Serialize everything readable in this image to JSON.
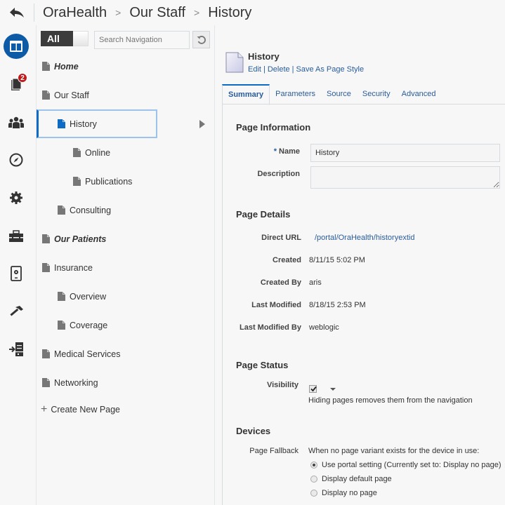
{
  "breadcrumb": [
    "OraHealth",
    "Our Staff",
    "History"
  ],
  "rail": {
    "items": [
      {
        "name": "pages-icon",
        "active": true
      },
      {
        "name": "assets-icon",
        "badge": "2"
      },
      {
        "name": "users-icon"
      },
      {
        "name": "navigation-icon"
      },
      {
        "name": "settings-icon"
      },
      {
        "name": "toolbox-icon"
      },
      {
        "name": "device-settings-icon"
      },
      {
        "name": "build-icon"
      },
      {
        "name": "import-export-icon"
      }
    ]
  },
  "nav": {
    "toggle_label": "All",
    "search_placeholder": "Search Navigation",
    "items": [
      {
        "label": "Home",
        "level": 0,
        "italic": true
      },
      {
        "label": "Our Staff",
        "level": 0
      },
      {
        "label": "History",
        "level": 1,
        "selected": true
      },
      {
        "label": "Online",
        "level": 2
      },
      {
        "label": "Publications",
        "level": 2
      },
      {
        "label": "Consulting",
        "level": 1
      },
      {
        "label": "Our Patients",
        "level": 0,
        "italic": true
      },
      {
        "label": "Insurance",
        "level": 0
      },
      {
        "label": "Overview",
        "level": 1
      },
      {
        "label": "Coverage",
        "level": 1
      },
      {
        "label": "Medical Services",
        "level": 0
      },
      {
        "label": "Networking",
        "level": 0
      }
    ],
    "create_label": "Create New Page"
  },
  "page": {
    "title": "History",
    "actions": [
      "Edit",
      "Delete",
      "Save As Page Style"
    ],
    "tabs": [
      "Summary",
      "Parameters",
      "Source",
      "Security",
      "Advanced"
    ],
    "active_tab": "Summary",
    "info": {
      "heading": "Page Information",
      "name_label": "Name",
      "name_value": "History",
      "description_label": "Description",
      "description_value": ""
    },
    "details": {
      "heading": "Page Details",
      "rows": [
        {
          "label": "Direct URL",
          "value": "/portal/OraHealth/historyextid",
          "link": true
        },
        {
          "label": "Created",
          "value": "8/11/15 5:02 PM"
        },
        {
          "label": "Created By",
          "value": "aris"
        },
        {
          "label": "Last Modified",
          "value": "8/18/15 2:53 PM"
        },
        {
          "label": "Last Modified By",
          "value": "weblogic"
        }
      ]
    },
    "status": {
      "heading": "Page Status",
      "visibility_label": "Visibility",
      "visible": true,
      "hint": "Hiding pages removes them from the navigation"
    },
    "devices": {
      "heading": "Devices",
      "fallback_label": "Page Fallback",
      "fallback_intro": "When no page variant exists for the device in use:",
      "options": [
        {
          "label": "Use portal setting (Currently set to: Display no page)",
          "selected": true
        },
        {
          "label": "Display default page",
          "selected": false
        },
        {
          "label": "Display no page",
          "selected": false
        }
      ]
    }
  }
}
